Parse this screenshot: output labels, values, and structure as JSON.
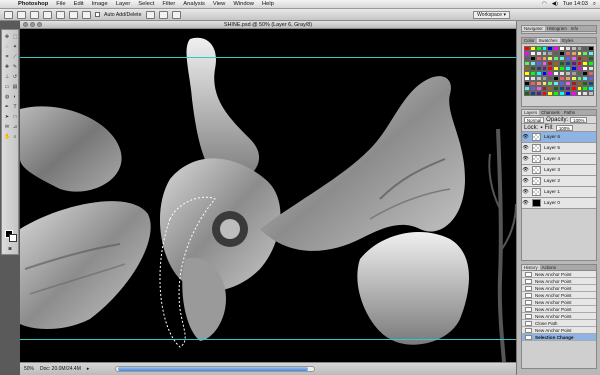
{
  "menubar": {
    "app_name": "Photoshop",
    "items": [
      "File",
      "Edit",
      "Image",
      "Layer",
      "Select",
      "Filter",
      "Analysis",
      "View",
      "Window",
      "Help"
    ],
    "clock": "Tue 14:03"
  },
  "options": {
    "auto_add_delete": "Auto Add/Delete",
    "workspace": "Workspace ▾"
  },
  "document": {
    "title": "SHINE.psd @ 50% (Layer 6, Gray/8)"
  },
  "status": {
    "zoom": "50%",
    "doc_info": "Doc: 20.0M/24.4M"
  },
  "panels": {
    "navigator_tabs": [
      "Navigator",
      "Histogram",
      "Info"
    ],
    "color_tabs": [
      "Color",
      "Swatches",
      "Styles"
    ],
    "layers_tabs": [
      "Layers",
      "Channels",
      "Paths"
    ],
    "layers_mode": "Normal",
    "opacity_label": "Opacity:",
    "opacity_value": "100%",
    "lock_label": "Lock:",
    "fill_label": "Fill:",
    "fill_value": "100%",
    "layers": [
      {
        "name": "Layer 6",
        "selected": true,
        "black": false
      },
      {
        "name": "Layer 5",
        "selected": false,
        "black": false
      },
      {
        "name": "Layer 4",
        "selected": false,
        "black": false
      },
      {
        "name": "Layer 3",
        "selected": false,
        "black": false
      },
      {
        "name": "Layer 2",
        "selected": false,
        "black": false
      },
      {
        "name": "Layer 1",
        "selected": false,
        "black": false
      },
      {
        "name": "Layer 0",
        "selected": false,
        "black": true
      }
    ],
    "history_tabs": [
      "History",
      "Actions"
    ],
    "history": [
      {
        "label": "New Anchor Point",
        "selected": false
      },
      {
        "label": "New Anchor Point",
        "selected": false
      },
      {
        "label": "New Anchor Point",
        "selected": false
      },
      {
        "label": "New Anchor Point",
        "selected": false
      },
      {
        "label": "New Anchor Point",
        "selected": false
      },
      {
        "label": "New Anchor Point",
        "selected": false
      },
      {
        "label": "New Anchor Point",
        "selected": false
      },
      {
        "label": "Close Path",
        "selected": false
      },
      {
        "label": "New Anchor Point",
        "selected": false
      },
      {
        "label": "Selection Change",
        "selected": true
      }
    ]
  },
  "colors": {
    "guide": "#36c8c8",
    "selection_highlight": "#8fb4e3"
  }
}
